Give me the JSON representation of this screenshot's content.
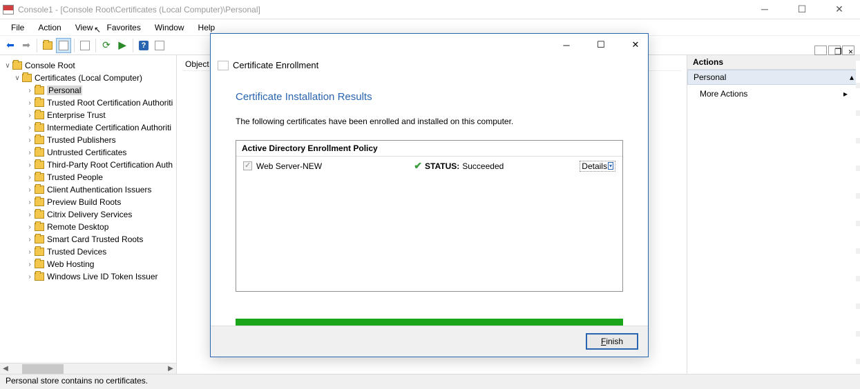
{
  "window": {
    "title": "Console1 - [Console Root\\Certificates (Local Computer)\\Personal]"
  },
  "menu": {
    "file": "File",
    "action": "Action",
    "view": "View",
    "favorites": "Favorites",
    "window": "Window",
    "help": "Help"
  },
  "tree": {
    "root": "Console Root",
    "certs": "Certificates (Local Computer)",
    "items": [
      "Personal",
      "Trusted Root Certification Authoriti",
      "Enterprise Trust",
      "Intermediate Certification Authoriti",
      "Trusted Publishers",
      "Untrusted Certificates",
      "Third-Party Root Certification Auth",
      "Trusted People",
      "Client Authentication Issuers",
      "Preview Build Roots",
      "Citrix Delivery Services",
      "Remote Desktop",
      "Smart Card Trusted Roots",
      "Trusted Devices",
      "Web Hosting",
      "Windows Live ID Token Issuer"
    ]
  },
  "content": {
    "header": "Object"
  },
  "actions": {
    "title": "Actions",
    "group": "Personal",
    "more": "More Actions"
  },
  "dialog": {
    "title": "Certificate Enrollment",
    "heading": "Certificate Installation Results",
    "text": "The following certificates have been enrolled and installed on this computer.",
    "policy_header": "Active Directory Enrollment Policy",
    "cert_name": "Web Server-NEW",
    "status_label": "STATUS:",
    "status_value": "Succeeded",
    "details": "Details",
    "finish": "Finish"
  },
  "statusbar": "Personal store contains no certificates."
}
